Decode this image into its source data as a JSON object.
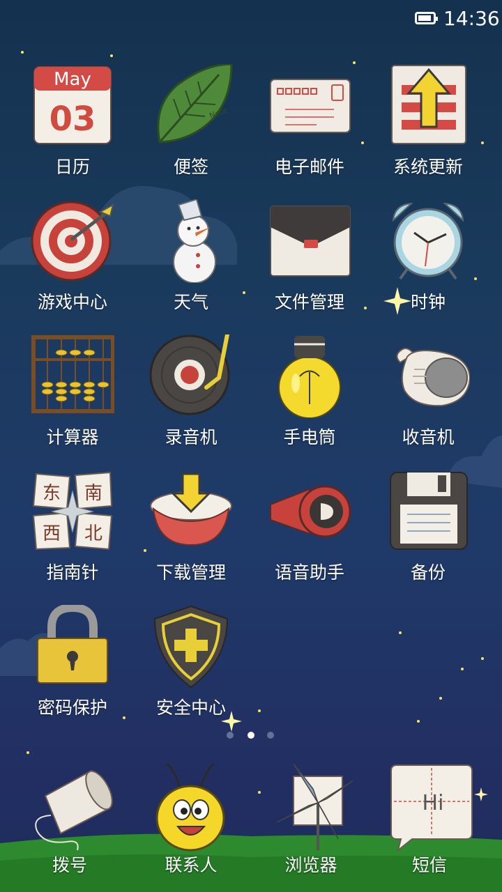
{
  "status_bar": {
    "time": "14:36",
    "battery_icon": "battery-icon"
  },
  "apps": [
    {
      "label": "日历",
      "icon": "calendar-icon",
      "month": "May",
      "day": "03"
    },
    {
      "label": "便签",
      "icon": "leaf-note-icon",
      "note_text": "Note"
    },
    {
      "label": "电子邮件",
      "icon": "envelope-icon"
    },
    {
      "label": "系统更新",
      "icon": "update-arrow-icon"
    },
    {
      "label": "游戏中心",
      "icon": "dartboard-icon"
    },
    {
      "label": "天气",
      "icon": "snowman-icon"
    },
    {
      "label": "文件管理",
      "icon": "folder-icon"
    },
    {
      "label": "时钟",
      "icon": "alarm-clock-icon"
    },
    {
      "label": "计算器",
      "icon": "abacus-icon"
    },
    {
      "label": "录音机",
      "icon": "record-player-icon"
    },
    {
      "label": "手电筒",
      "icon": "light-bulb-icon"
    },
    {
      "label": "收音机",
      "icon": "radio-icon"
    },
    {
      "label": "指南针",
      "icon": "compass-icon",
      "directions": [
        "东",
        "南",
        "西",
        "北"
      ]
    },
    {
      "label": "下载管理",
      "icon": "download-bowl-icon"
    },
    {
      "label": "语音助手",
      "icon": "megaphone-icon"
    },
    {
      "label": "备份",
      "icon": "floppy-disk-icon"
    },
    {
      "label": "密码保护",
      "icon": "padlock-icon"
    },
    {
      "label": "安全中心",
      "icon": "shield-icon"
    }
  ],
  "page_indicator": {
    "count": 3,
    "active": 2
  },
  "dock": [
    {
      "label": "拨号",
      "icon": "cup-phone-icon"
    },
    {
      "label": "联系人",
      "icon": "bee-face-icon"
    },
    {
      "label": "浏览器",
      "icon": "pinwheel-icon"
    },
    {
      "label": "短信",
      "icon": "speech-bubble-icon",
      "bubble_text": "Hi"
    }
  ]
}
